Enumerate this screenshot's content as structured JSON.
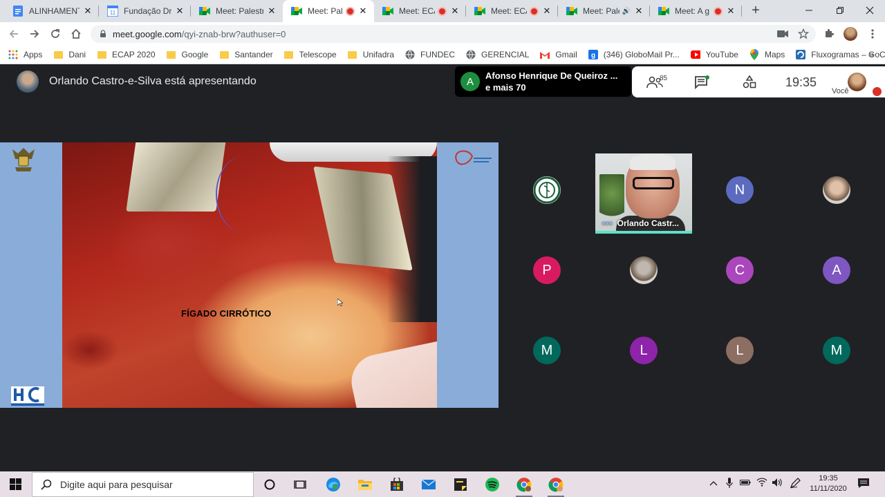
{
  "browser": {
    "tabs": [
      {
        "title": "ALINHAMENTO",
        "icon": "docs-icon",
        "recording": false
      },
      {
        "title": "Fundação Drac",
        "icon": "calendar-icon",
        "recording": false
      },
      {
        "title": "Meet: Palestra",
        "icon": "meet-icon",
        "recording": false
      },
      {
        "title": "Meet: Pale",
        "icon": "meet-icon",
        "recording": true,
        "active": true
      },
      {
        "title": "Meet: ECA",
        "icon": "meet-icon",
        "recording": true
      },
      {
        "title": "Meet: ECA",
        "icon": "meet-icon",
        "recording": true
      },
      {
        "title": "Meet: Pale",
        "icon": "meet-icon",
        "recording": false,
        "audio": true
      },
      {
        "title": "Meet: A g",
        "icon": "meet-icon",
        "recording": true
      }
    ],
    "new_tab_label": "+",
    "url_host": "meet.google.com",
    "url_path": "/qyi-znab-brw?authuser=0",
    "bookmarks": [
      {
        "label": "Apps",
        "icon": "apps-grid-icon"
      },
      {
        "label": "Dani",
        "icon": "folder-icon"
      },
      {
        "label": "ECAP 2020",
        "icon": "folder-icon"
      },
      {
        "label": "Google",
        "icon": "folder-icon"
      },
      {
        "label": "Santander",
        "icon": "folder-icon"
      },
      {
        "label": "Telescope",
        "icon": "folder-icon"
      },
      {
        "label": "Unifadra",
        "icon": "folder-icon"
      },
      {
        "label": "FUNDEC",
        "icon": "globe-icon"
      },
      {
        "label": "GERENCIAL",
        "icon": "globe-icon"
      },
      {
        "label": "Gmail",
        "icon": "gmail-icon"
      },
      {
        "label": "(346) GloboMail Pr...",
        "icon": "globomail-icon"
      },
      {
        "label": "YouTube",
        "icon": "youtube-icon"
      },
      {
        "label": "Maps",
        "icon": "maps-icon"
      },
      {
        "label": "Fluxogramas – GoC...",
        "icon": "gocharts-icon"
      }
    ],
    "more_bookmarks": "»"
  },
  "meet": {
    "presenter_text": "Orlando Castro-e-Silva está apresentando",
    "chat": {
      "initial": "A",
      "line1": "Afonso Henrique De Queiroz ...",
      "line2": "e mais 70"
    },
    "participant_count": "85",
    "time": "19:35",
    "you_label": "Você",
    "slide_label": "FÍGADO CIRRÓTICO",
    "video_tile_name": "Orlando Castr...",
    "tiles": [
      {
        "initial": "",
        "color": "#ffffff",
        "kind": "logo"
      },
      {
        "initial": "N",
        "color": "#5c6bc0"
      },
      {
        "initial": "",
        "color": "#e0c0a8",
        "kind": "photo"
      },
      {
        "initial": "P",
        "color": "#d81b60"
      },
      {
        "initial": "",
        "color": "#c0b8b0",
        "kind": "photo"
      },
      {
        "initial": "C",
        "color": "#ab47bc"
      },
      {
        "initial": "A",
        "color": "#7e57c2"
      },
      {
        "initial": "M",
        "color": "#00695c"
      },
      {
        "initial": "L",
        "color": "#8e24aa"
      },
      {
        "initial": "L",
        "color": "#8d6e63"
      },
      {
        "initial": "M",
        "color": "#00695c"
      }
    ]
  },
  "taskbar": {
    "search_placeholder": "Digite aqui para pesquisar",
    "clock_time": "19:35",
    "clock_date": "11/11/2020"
  }
}
